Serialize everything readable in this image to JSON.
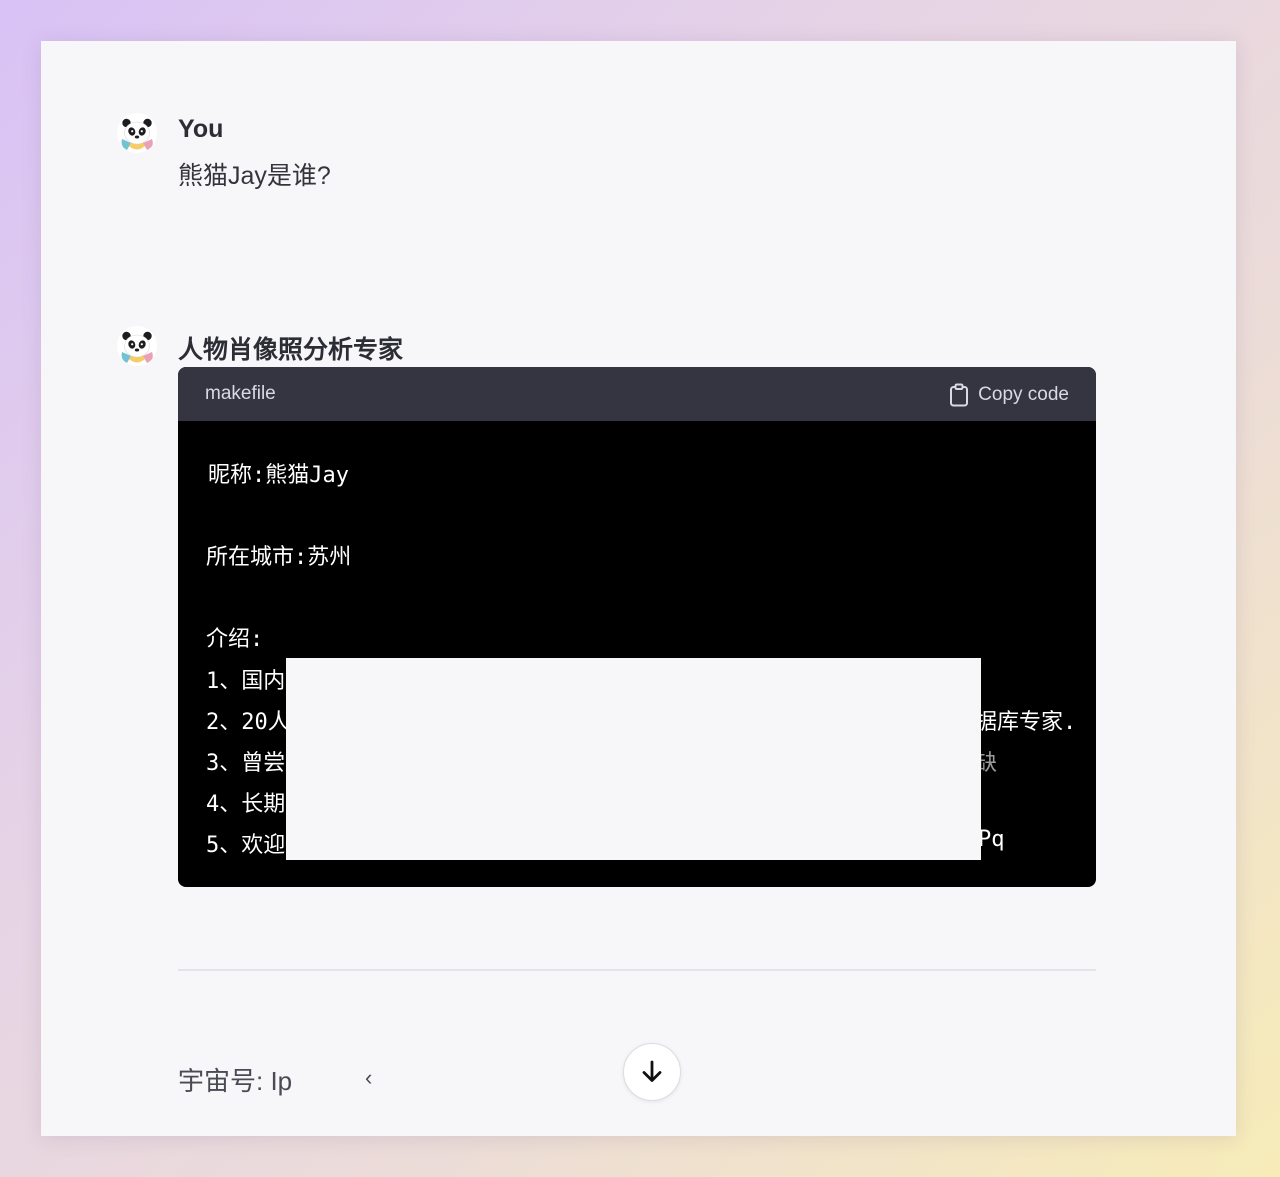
{
  "messages": [
    {
      "sender": "You",
      "avatar_icon": "panda-avatar-icon",
      "text": "熊猫Jay是谁?"
    },
    {
      "sender": "人物肖像照分析专家",
      "avatar_icon": "panda-avatar-icon",
      "code_block": {
        "language": "makefile",
        "copy_label": "Copy code",
        "copy_icon": "clipboard-icon",
        "lines": [
          "昵称:熊猫Jay",
          "所在城市:苏州",
          "介绍:",
          "1、国内",
          "2、20人",
          "3、曾尝",
          "4、长期",
          "5、欢迎"
        ],
        "visible_fragments": [
          "据库专家.",
          "缺",
          "Pq"
        ]
      }
    }
  ],
  "footer": {
    "text": "宇宙号: Ip",
    "fragment": "‹"
  },
  "scroll_button_icon": "arrow-down-icon",
  "colors": {
    "page_bg": "#f7f7f9",
    "code_bg": "#000000",
    "code_header_bg": "#343541",
    "text": "#2d2d35"
  }
}
